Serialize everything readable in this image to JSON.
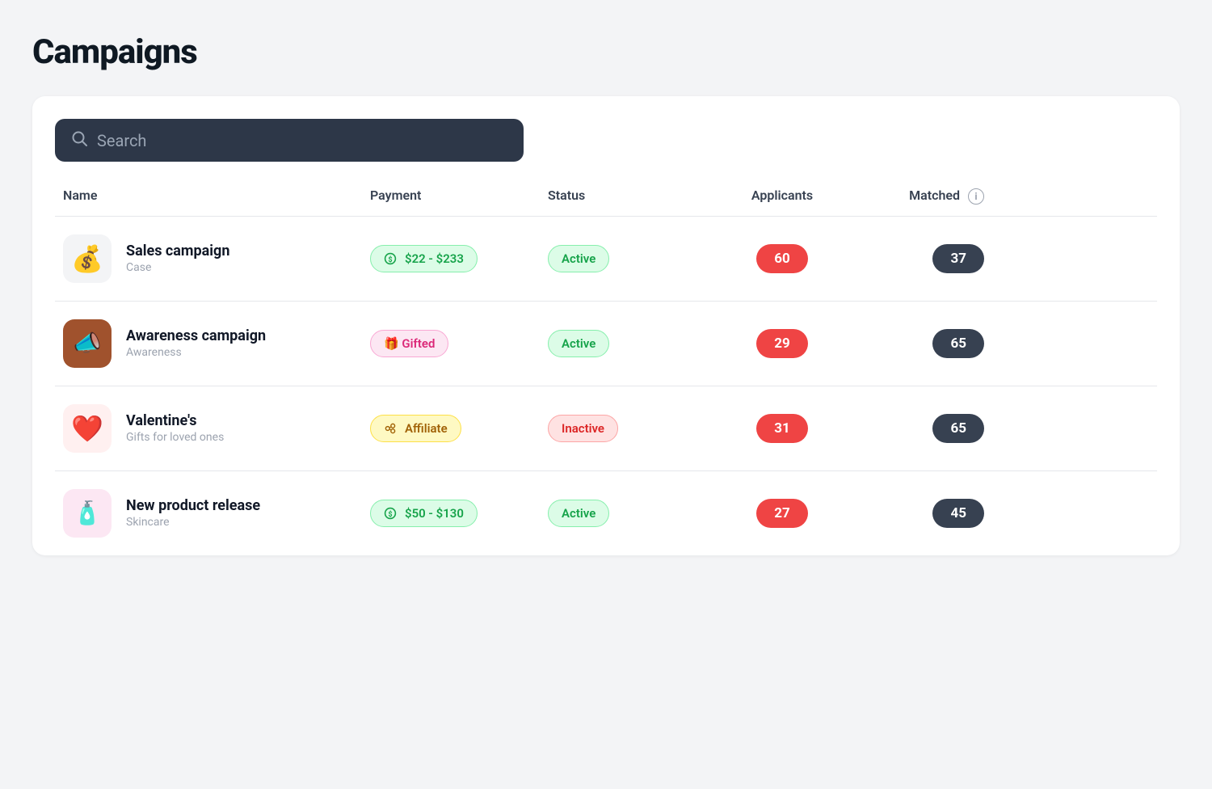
{
  "page": {
    "title": "Campaigns"
  },
  "search": {
    "placeholder": "Search"
  },
  "table": {
    "columns": [
      "Name",
      "Payment",
      "Status",
      "Applicants",
      "Matched"
    ],
    "rows": [
      {
        "id": 1,
        "name": "Sales campaign",
        "sub": "Case",
        "icon_type": "money_bag",
        "icon_emoji": "💰",
        "icon_style": "light",
        "payment_label": "$22 - $233",
        "payment_icon": "💰",
        "payment_type": "range",
        "status": "Active",
        "status_type": "active",
        "applicants": 60,
        "matched": 37
      },
      {
        "id": 2,
        "name": "Awareness campaign",
        "sub": "Awareness",
        "icon_type": "megaphone",
        "icon_emoji": "📣",
        "icon_style": "brown",
        "payment_label": "Gifted",
        "payment_icon": "🎁",
        "payment_type": "gifted",
        "status": "Active",
        "status_type": "active",
        "applicants": 29,
        "matched": 65
      },
      {
        "id": 3,
        "name": "Valentine's",
        "sub": "Gifts for loved ones",
        "icon_type": "heart",
        "icon_emoji": "❤️",
        "icon_style": "red",
        "payment_label": "Affiliate",
        "payment_icon": "🔗",
        "payment_type": "affiliate",
        "status": "Inactive",
        "status_type": "inactive",
        "applicants": 31,
        "matched": 65
      },
      {
        "id": 4,
        "name": "New product release",
        "sub": "Skincare",
        "icon_type": "skincare",
        "icon_emoji": "🧴",
        "icon_style": "pink",
        "payment_label": "$50 - $130",
        "payment_icon": "💰",
        "payment_type": "range",
        "status": "Active",
        "status_type": "active",
        "applicants": 27,
        "matched": 45
      }
    ]
  },
  "icons": {
    "search": "🔍",
    "info": "i"
  }
}
